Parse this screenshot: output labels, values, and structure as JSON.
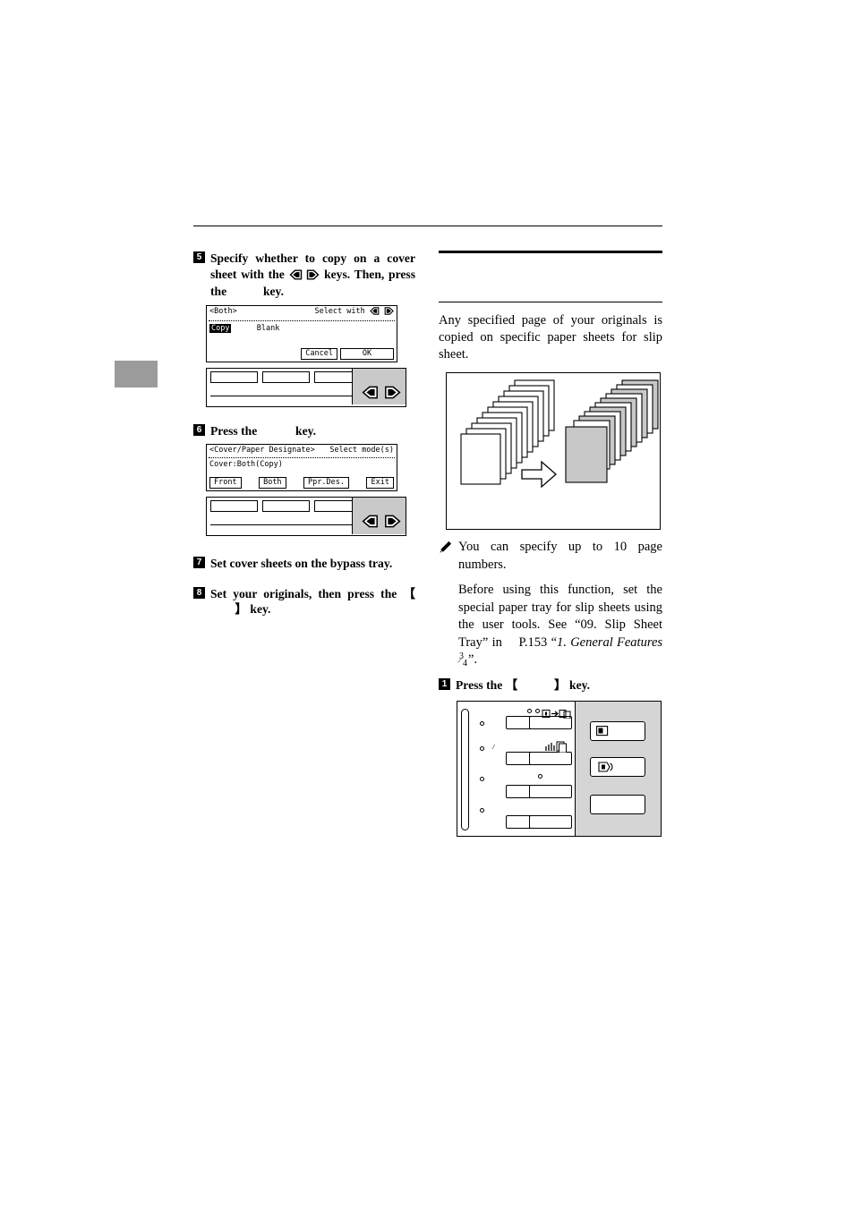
{
  "left_column": {
    "steps": [
      {
        "num": "5",
        "text_parts": {
          "before": "Specify whether to copy on a cover sheet with the",
          "after": "keys. Then, press the",
          "tail": "key."
        }
      },
      {
        "num": "6",
        "text_parts": {
          "before": "Press the",
          "after": "key."
        }
      },
      {
        "num": "7",
        "text": "Set cover sheets on the bypass tray."
      },
      {
        "num": "8",
        "text_parts": {
          "before": "Set your originals, then press the",
          "bracket_open": "【",
          "bracket_close": "】",
          "tail": "key."
        }
      }
    ],
    "lcd_1": {
      "title": "<Both>",
      "hint": "Select with",
      "option_selected": "Copy",
      "option_other": "Blank",
      "btn_cancel": "Cancel",
      "btn_ok": "OK"
    },
    "lcd_2": {
      "title": "<Cover/Paper Designate>",
      "hint": "Select mode(s)",
      "status": "Cover:Both(Copy)",
      "btn_front": "Front",
      "btn_both": "Both",
      "btn_ppr": "Ppr.Des.",
      "btn_exit": "Exit"
    }
  },
  "right_column": {
    "intro": "Any specified page of your originals is copied on specific paper sheets for slip sheet.",
    "notes": [
      "You can specify up to 10 page numbers."
    ],
    "note2": {
      "part1": "Before using this function, set the special paper tray for slip sheets using the user tools. See “09. Slip Sheet Tray” in",
      "ref": "P.153",
      "quote_open": "“",
      "italic": "1. General Features",
      "frac_n": "3",
      "frac_d": "4",
      "quote_close": "”",
      "period": "."
    },
    "step1": {
      "num": "1",
      "before": "Press the",
      "bracket_open": "【",
      "bracket_close": "】",
      "tail": "key."
    }
  },
  "colors": {
    "ink": "#000000",
    "chapter_tab": "#9b9b9b",
    "panel_grey": "#c9c9c9",
    "operation_panel_grey": "#d5d5d5",
    "paper_shade": "#c8c8c8"
  },
  "icons": {
    "left_arrow": "left-arrow-key-icon",
    "right_arrow": "right-arrow-key-icon",
    "pencil": "pencil-note-icon",
    "big_arrow": "process-arrow-icon"
  }
}
